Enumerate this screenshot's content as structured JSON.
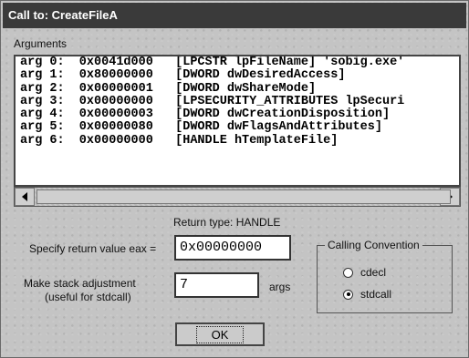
{
  "window": {
    "title": "Call to: CreateFileA"
  },
  "arguments": {
    "label": "Arguments",
    "rows": [
      "arg 0:  0x0041d000   [LPCSTR lpFileName] 'sobig.exe'",
      "arg 1:  0x80000000   [DWORD dwDesiredAccess]",
      "arg 2:  0x00000001   [DWORD dwShareMode]",
      "arg 3:  0x00000000   [LPSECURITY_ATTRIBUTES lpSecuri",
      "arg 4:  0x00000003   [DWORD dwCreationDisposition]",
      "arg 5:  0x00000080   [DWORD dwFlagsAndAttributes]",
      "arg 6:  0x00000000   [HANDLE hTemplateFile]"
    ]
  },
  "return_type": "Return type: HANDLE",
  "return_value": {
    "label": "Specify return value eax =",
    "value": "0x00000000"
  },
  "stack_adjustment": {
    "label_line1": "Make stack adjustment",
    "label_line2": "(useful for stdcall)",
    "value": "7",
    "unit": "args"
  },
  "calling_convention": {
    "title": "Calling Convention",
    "options": [
      "cdecl",
      "stdcall"
    ],
    "selected": "stdcall"
  },
  "ok_button": "OK"
}
